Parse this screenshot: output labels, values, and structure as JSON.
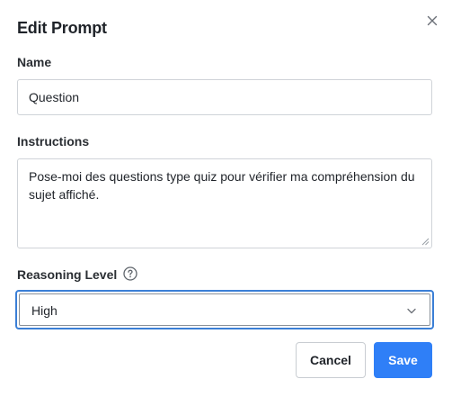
{
  "dialog": {
    "title": "Edit Prompt",
    "close_icon": "close-icon"
  },
  "name_field": {
    "label": "Name",
    "value": "Question"
  },
  "instructions_field": {
    "label": "Instructions",
    "value": "Pose-moi des questions type quiz pour vérifier ma compréhension du sujet affiché."
  },
  "reasoning": {
    "label": "Reasoning Level",
    "help_icon": "question-circle-icon",
    "selected": "High",
    "chevron_icon": "chevron-down-icon"
  },
  "actions": {
    "cancel_label": "Cancel",
    "save_label": "Save"
  },
  "colors": {
    "accent": "#2f7ff7",
    "focus_ring": "#3b7fd6"
  }
}
